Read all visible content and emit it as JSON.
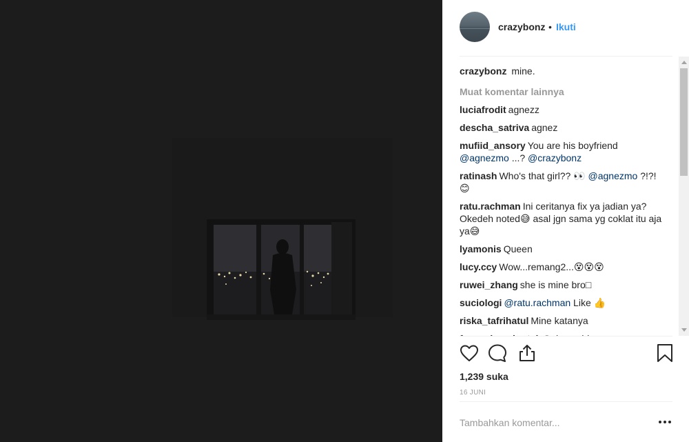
{
  "post": {
    "username": "crazybonz",
    "separator": "•",
    "follow_label": "Ikuti",
    "caption": "mine.",
    "load_more_label": "Muat komentar lainnya",
    "likes": "1,239 suka",
    "date": "16 JUNI",
    "add_comment_placeholder": "Tambahkan komentar..."
  },
  "comments": [
    {
      "user": "luciafrodit",
      "parts": [
        {
          "text": "agnezz"
        }
      ]
    },
    {
      "user": "descha_satriva",
      "parts": [
        {
          "text": "agnez"
        }
      ]
    },
    {
      "user": "mufiid_ansory",
      "parts": [
        {
          "text": "You are his boyfriend "
        },
        {
          "text": "@agnezmo",
          "mention": true
        },
        {
          "text": " ...? "
        },
        {
          "text": "@crazybonz",
          "mention": true
        }
      ]
    },
    {
      "user": "ratinash",
      "parts": [
        {
          "text": "Who's that girl?? 👀 "
        },
        {
          "text": "@agnezmo",
          "mention": true
        },
        {
          "text": " ?!?! 😊"
        }
      ]
    },
    {
      "user": "ratu.rachman",
      "parts": [
        {
          "text": "Ini ceritanya fix ya jadian ya? Okedeh noted😅 asal jgn sama yg coklat itu aja ya😅"
        }
      ]
    },
    {
      "user": "lyamonis",
      "parts": [
        {
          "text": "Queen"
        }
      ]
    },
    {
      "user": "lucy.ccy",
      "parts": [
        {
          "text": "Wow...remang2...😵😵😵"
        }
      ]
    },
    {
      "user": "ruwei_zhang",
      "parts": [
        {
          "text": "she is mine bro□"
        }
      ]
    },
    {
      "user": "suciologi",
      "parts": [
        {
          "text": "@ratu.rachman",
          "mention": true
        },
        {
          "text": " Like 👍"
        }
      ]
    },
    {
      "user": "riska_tafrihatul",
      "parts": [
        {
          "text": "Mine katanya"
        }
      ]
    },
    {
      "user": "fany_simanjuntak",
      "parts": [
        {
          "text": "Gelap yahh"
        }
      ]
    }
  ],
  "icons": {
    "like": "heart-icon",
    "comment": "speech-bubble-icon",
    "share": "share-icon",
    "save": "bookmark-icon",
    "more": "more-options-icon"
  },
  "colors": {
    "link": "#3897f0",
    "mention": "#003569",
    "muted": "#999999",
    "photo_background": "#1c1c1c"
  }
}
